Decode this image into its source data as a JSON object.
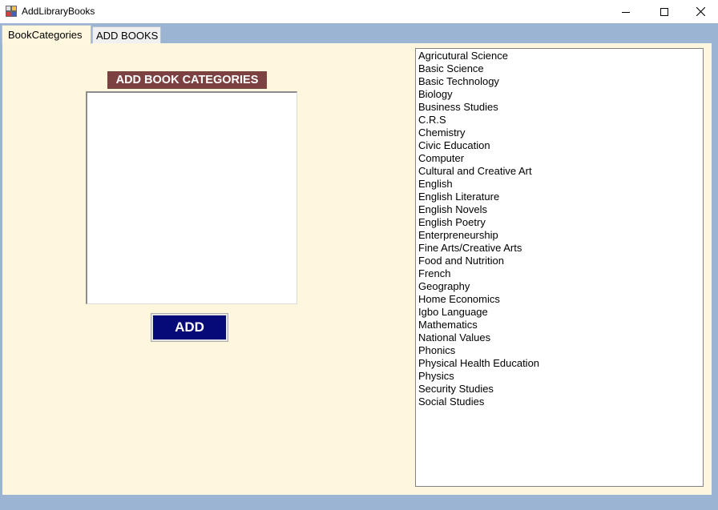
{
  "window": {
    "title": "AddLibraryBooks",
    "controls": [
      "minimize-icon",
      "maximize-icon",
      "close-icon"
    ]
  },
  "tabs": [
    {
      "label": "BookCategories",
      "active": true
    },
    {
      "label": "ADD BOOKS",
      "active": false
    }
  ],
  "form": {
    "header": "ADD BOOK CATEGORIES",
    "input_value": "",
    "add_button": "ADD"
  },
  "categories": [
    "Agricutural Science",
    "Basic Science",
    "Basic Technology",
    "Biology",
    "Business Studies",
    "C.R.S",
    "Chemistry",
    "Civic Education",
    "Computer",
    "Cultural and Creative Art",
    "English",
    "English Literature",
    "English Novels",
    "English Poetry",
    "Enterpreneurship",
    "Fine Arts/Creative Arts",
    "Food and Nutrition",
    "French",
    "Geography",
    "Home Economics",
    "Igbo Language",
    "Mathematics",
    "National Values",
    "Phonics",
    "Physical Health Education",
    "Physics",
    "Security Studies",
    "Social Studies"
  ],
  "colors": {
    "panel_bg": "#fff7dd",
    "frame_bg": "#9bb4d3",
    "header_bg": "#7c4141",
    "button_bg": "#050a78"
  }
}
